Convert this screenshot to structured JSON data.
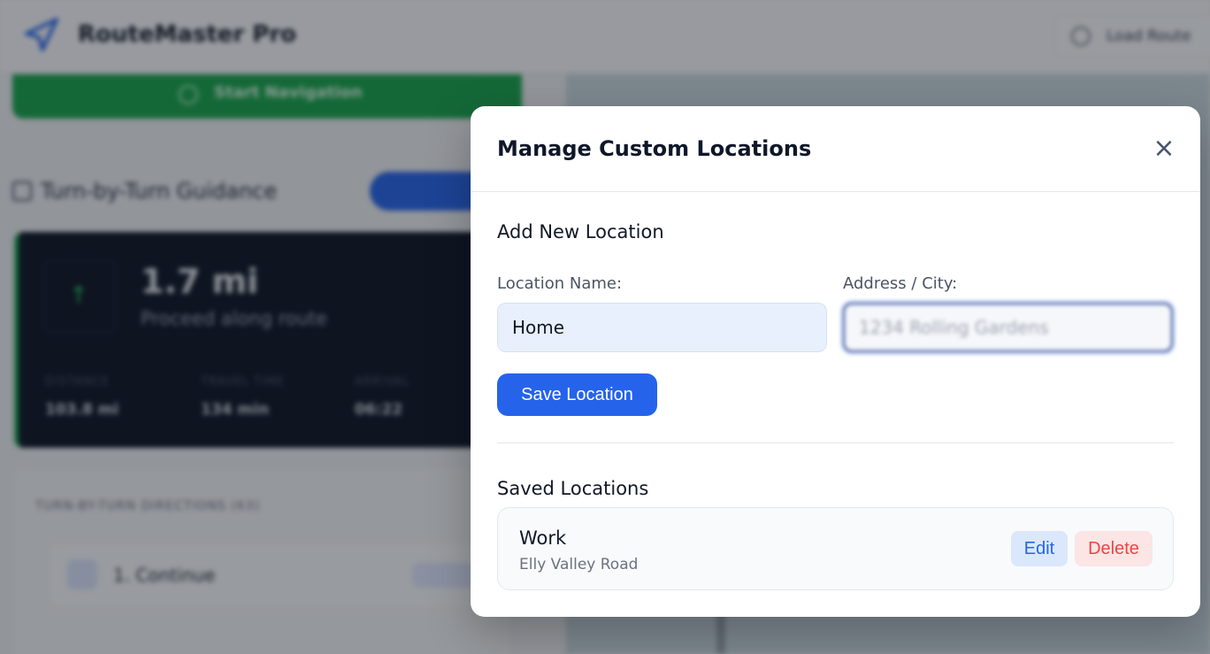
{
  "app": {
    "brand": "RouteMaster Pro",
    "load_label": "Load Route",
    "nav_label": "Start Navigation",
    "turn_title": "Turn-by-Turn Guidance",
    "card": {
      "distance": "1.7 mi",
      "instruction": "Proceed along route",
      "stats": [
        {
          "label": "DISTANCE",
          "value": "103.8 mi"
        },
        {
          "label": "TRAVEL TIME",
          "value": "134 min"
        },
        {
          "label": "ARRIVAL",
          "value": "06:22"
        }
      ]
    },
    "list": {
      "heading": "TURN-BY-TURN DIRECTIONS (63)",
      "first_row": "1. Continue"
    }
  },
  "modal": {
    "title": "Manage Custom Locations",
    "close_glyph": "×",
    "add_section_title": "Add New Location",
    "name_label": "Location Name:",
    "name_value": "Home",
    "address_label": "Address / City:",
    "address_value": "1234 Rolling Gardens",
    "save_label": "Save Location",
    "saved_section_title": "Saved Locations",
    "saved": [
      {
        "name": "Work",
        "address": "Elly Valley Road",
        "edit_label": "Edit",
        "delete_label": "Delete"
      }
    ]
  },
  "colors": {
    "primary": "#2563eb",
    "success": "#16a34a",
    "danger": "#ef4444"
  }
}
